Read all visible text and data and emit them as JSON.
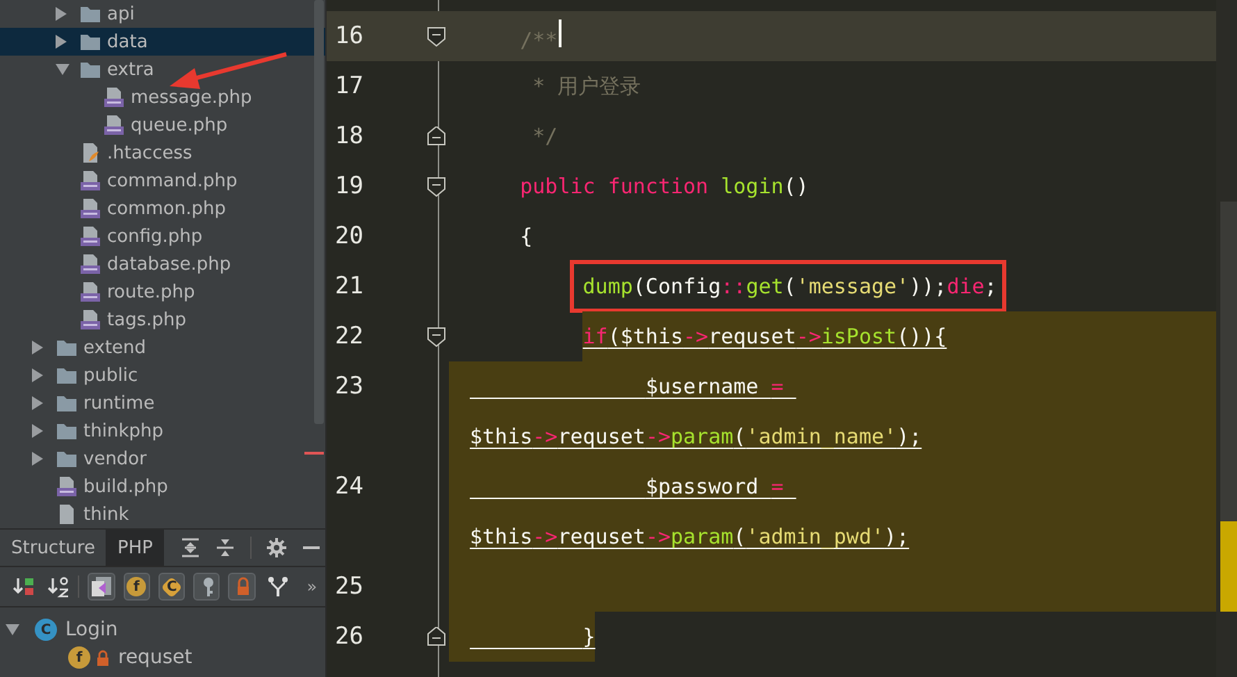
{
  "project_tree": {
    "items": [
      {
        "children": [
          {
            "label": "api",
            "kind": "folder",
            "expanded": false,
            "selected": false
          },
          {
            "label": "data",
            "kind": "folder",
            "expanded": false,
            "selected": true
          },
          {
            "label": "extra",
            "kind": "folder",
            "expanded": true,
            "selected": false,
            "children": [
              {
                "label": "message.php",
                "kind": "php",
                "selected": false
              },
              {
                "label": "queue.php",
                "kind": "php",
                "selected": false
              }
            ]
          },
          {
            "label": ".htaccess",
            "kind": "htaccess",
            "selected": false
          },
          {
            "label": "command.php",
            "kind": "php",
            "selected": false
          },
          {
            "label": "common.php",
            "kind": "php",
            "selected": false
          },
          {
            "label": "config.php",
            "kind": "php",
            "selected": false
          },
          {
            "label": "database.php",
            "kind": "php",
            "selected": false
          },
          {
            "label": "route.php",
            "kind": "php",
            "selected": false
          },
          {
            "label": "tags.php",
            "kind": "php",
            "selected": false
          }
        ]
      },
      {
        "label": "extend",
        "kind": "folder",
        "expanded": false,
        "selected": false
      },
      {
        "label": "public",
        "kind": "folder",
        "expanded": false,
        "selected": false
      },
      {
        "label": "runtime",
        "kind": "folder",
        "expanded": false,
        "selected": false
      },
      {
        "label": "thinkphp",
        "kind": "folder",
        "expanded": false,
        "selected": false
      },
      {
        "label": "vendor",
        "kind": "folder",
        "expanded": false,
        "selected": false
      },
      {
        "label": "build.php",
        "kind": "php",
        "selected": false
      },
      {
        "label": "think",
        "kind": "file",
        "selected": false
      }
    ]
  },
  "structure": {
    "tabs": [
      {
        "label": "Structure",
        "selected": false
      },
      {
        "label": "PHP",
        "selected": true
      }
    ],
    "header_icons": [
      {
        "kind": "expand_all"
      },
      {
        "kind": "collapse_all"
      },
      {
        "kind": "settings"
      },
      {
        "kind": "minimize"
      }
    ],
    "toolbar": [
      {
        "kind": "sort_visibility"
      },
      {
        "kind": "sort_alpha"
      },
      {
        "kind": "inherited"
      },
      {
        "kind": "fields",
        "glyph": "f"
      },
      {
        "kind": "constants",
        "glyph": "C"
      },
      {
        "kind": "key"
      },
      {
        "kind": "lock"
      },
      {
        "kind": "filter"
      },
      {
        "kind": "more",
        "glyph": "»"
      }
    ],
    "tree": [
      {
        "label": "Login",
        "kind": "class",
        "glyph": "C",
        "expanded": true,
        "children": [
          {
            "label": "requset",
            "kind": "field",
            "glyph": "f",
            "private": true
          }
        ]
      }
    ]
  },
  "editor": {
    "rows": [
      {
        "number": "16",
        "kind": "normal",
        "fold_open": true,
        "current": true,
        "cursor": true,
        "segments": [
          {
            "text": "    /**",
            "kind": "comment"
          }
        ]
      },
      {
        "number": "17",
        "kind": "normal",
        "segments": [
          {
            "text": "     * 用户登录",
            "kind": "comment"
          }
        ]
      },
      {
        "number": "18",
        "kind": "normal",
        "fold_close": true,
        "segments": [
          {
            "text": "     */",
            "kind": "comment"
          }
        ]
      },
      {
        "number": "19",
        "kind": "normal",
        "fold_open": true,
        "segments": [
          {
            "text": "    public function",
            "kind": "keyword"
          },
          {
            "text": " login",
            "kind": "func"
          },
          {
            "text": "()",
            "kind": "plain"
          }
        ]
      },
      {
        "number": "20",
        "kind": "normal",
        "segments": [
          {
            "text": "    {",
            "kind": "plain"
          }
        ]
      },
      {
        "number": "21",
        "kind": "normal",
        "boxed": true,
        "segments": [
          {
            "text": "         dump",
            "kind": "func"
          },
          {
            "text": "(Config",
            "kind": "plain"
          },
          {
            "text": "::",
            "kind": "op"
          },
          {
            "text": "get",
            "kind": "func"
          },
          {
            "text": "(",
            "kind": "plain"
          },
          {
            "text": "'message'",
            "kind": "string"
          },
          {
            "text": "));",
            "kind": "plain"
          },
          {
            "text": "die",
            "kind": "keyword"
          },
          {
            "text": ";",
            "kind": "plain"
          }
        ]
      },
      {
        "number": "22",
        "kind": "matchstart",
        "fold_open": true,
        "underlined": true,
        "segments": [
          {
            "text": "         if",
            "kind": "keyword"
          },
          {
            "text": "($this",
            "kind": "plain"
          },
          {
            "text": "->",
            "kind": "op"
          },
          {
            "text": "requset",
            "kind": "plain"
          },
          {
            "text": "->",
            "kind": "op"
          },
          {
            "text": "isPost",
            "kind": "func"
          },
          {
            "text": "()){",
            "kind": "plain"
          }
        ]
      },
      {
        "number": "23",
        "kind": "match",
        "underlined": true,
        "segments": [
          {
            "text": "              $username ",
            "kind": "plain"
          },
          {
            "text": "= ",
            "kind": "op"
          }
        ]
      },
      {
        "kind": "match",
        "underlined": true,
        "segments": [
          {
            "text": "$this",
            "kind": "plain"
          },
          {
            "text": "->",
            "kind": "op"
          },
          {
            "text": "requset",
            "kind": "plain"
          },
          {
            "text": "->",
            "kind": "op"
          },
          {
            "text": "param",
            "kind": "func"
          },
          {
            "text": "(",
            "kind": "plain"
          },
          {
            "text": "'admin_name'",
            "kind": "string"
          },
          {
            "text": ");",
            "kind": "plain"
          }
        ]
      },
      {
        "number": "24",
        "kind": "match",
        "underlined": true,
        "segments": [
          {
            "text": "              $password ",
            "kind": "plain"
          },
          {
            "text": "= ",
            "kind": "op"
          }
        ]
      },
      {
        "kind": "match",
        "underlined": true,
        "segments": [
          {
            "text": "$this",
            "kind": "plain"
          },
          {
            "text": "->",
            "kind": "op"
          },
          {
            "text": "requset",
            "kind": "plain"
          },
          {
            "text": "->",
            "kind": "op"
          },
          {
            "text": "param",
            "kind": "func"
          },
          {
            "text": "(",
            "kind": "plain"
          },
          {
            "text": "'admin_pwd'",
            "kind": "string"
          },
          {
            "text": ");",
            "kind": "plain"
          }
        ]
      },
      {
        "number": "25",
        "kind": "match",
        "segments": []
      },
      {
        "number": "26",
        "kind": "matchend",
        "fold_close": true,
        "underlined": true,
        "segments": [
          {
            "text": "         }",
            "kind": "plain"
          }
        ]
      }
    ]
  }
}
